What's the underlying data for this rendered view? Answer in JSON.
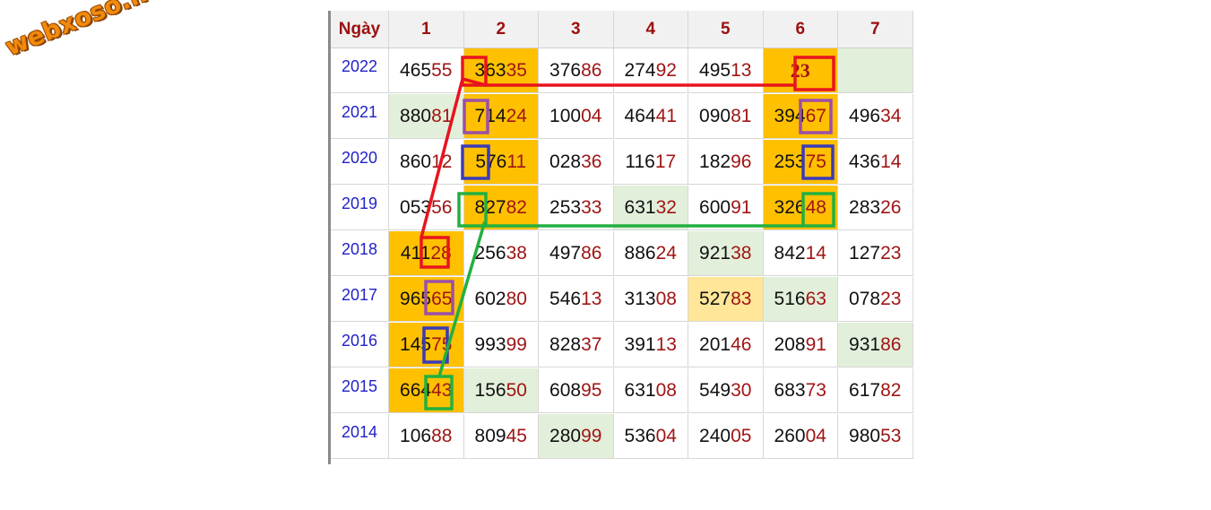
{
  "logo_text": "webxoso.net",
  "header": {
    "day_label": "Ngày",
    "months": [
      "1",
      "2",
      "3",
      "4",
      "5",
      "6",
      "7"
    ]
  },
  "rows": [
    {
      "year": "2022",
      "cells": [
        {
          "head": "465",
          "tail": "55",
          "bg": ""
        },
        {
          "head": "363",
          "tail": "35",
          "bg": "orange"
        },
        {
          "head": "376",
          "tail": "86",
          "bg": ""
        },
        {
          "head": "274",
          "tail": "92",
          "bg": ""
        },
        {
          "head": "495",
          "tail": "13",
          "bg": ""
        },
        {
          "head": "",
          "tail": "23",
          "bg": "orange",
          "special": true
        },
        {
          "head": "",
          "tail": "",
          "bg": "green"
        }
      ]
    },
    {
      "year": "2021",
      "cells": [
        {
          "head": "880",
          "tail": "81",
          "bg": "green"
        },
        {
          "head": "714",
          "tail": "24",
          "bg": "orange"
        },
        {
          "head": "100",
          "tail": "04",
          "bg": ""
        },
        {
          "head": "464",
          "tail": "41",
          "bg": ""
        },
        {
          "head": "090",
          "tail": "81",
          "bg": ""
        },
        {
          "head": "394",
          "tail": "67",
          "bg": "orange"
        },
        {
          "head": "496",
          "tail": "34",
          "bg": ""
        }
      ]
    },
    {
      "year": "2020",
      "cells": [
        {
          "head": "860",
          "tail": "12",
          "bg": ""
        },
        {
          "head": "576",
          "tail": "11",
          "bg": "orange"
        },
        {
          "head": "028",
          "tail": "36",
          "bg": ""
        },
        {
          "head": "116",
          "tail": "17",
          "bg": ""
        },
        {
          "head": "182",
          "tail": "96",
          "bg": ""
        },
        {
          "head": "253",
          "tail": "75",
          "bg": "orange"
        },
        {
          "head": "436",
          "tail": "14",
          "bg": ""
        }
      ]
    },
    {
      "year": "2019",
      "cells": [
        {
          "head": "053",
          "tail": "56",
          "bg": ""
        },
        {
          "head": "827",
          "tail": "82",
          "bg": "orange"
        },
        {
          "head": "253",
          "tail": "33",
          "bg": ""
        },
        {
          "head": "631",
          "tail": "32",
          "bg": "green"
        },
        {
          "head": "600",
          "tail": "91",
          "bg": ""
        },
        {
          "head": "326",
          "tail": "48",
          "bg": "orange"
        },
        {
          "head": "283",
          "tail": "26",
          "bg": ""
        }
      ]
    },
    {
      "year": "2018",
      "cells": [
        {
          "head": "411",
          "tail": "28",
          "bg": "orange"
        },
        {
          "head": "256",
          "tail": "38",
          "bg": ""
        },
        {
          "head": "497",
          "tail": "86",
          "bg": ""
        },
        {
          "head": "886",
          "tail": "24",
          "bg": ""
        },
        {
          "head": "921",
          "tail": "38",
          "bg": "green"
        },
        {
          "head": "842",
          "tail": "14",
          "bg": ""
        },
        {
          "head": "127",
          "tail": "23",
          "bg": ""
        }
      ]
    },
    {
      "year": "2017",
      "cells": [
        {
          "head": "965",
          "tail": "65",
          "bg": "orange"
        },
        {
          "head": "602",
          "tail": "80",
          "bg": ""
        },
        {
          "head": "546",
          "tail": "13",
          "bg": ""
        },
        {
          "head": "313",
          "tail": "08",
          "bg": ""
        },
        {
          "head": "527",
          "tail": "83",
          "bg": "yellow"
        },
        {
          "head": "516",
          "tail": "63",
          "bg": "green"
        },
        {
          "head": "078",
          "tail": "23",
          "bg": ""
        }
      ]
    },
    {
      "year": "2016",
      "cells": [
        {
          "head": "145",
          "tail": "75",
          "bg": "orange"
        },
        {
          "head": "993",
          "tail": "99",
          "bg": ""
        },
        {
          "head": "828",
          "tail": "37",
          "bg": ""
        },
        {
          "head": "391",
          "tail": "13",
          "bg": ""
        },
        {
          "head": "201",
          "tail": "46",
          "bg": ""
        },
        {
          "head": "208",
          "tail": "91",
          "bg": ""
        },
        {
          "head": "931",
          "tail": "86",
          "bg": "green"
        }
      ]
    },
    {
      "year": "2015",
      "cells": [
        {
          "head": "664",
          "tail": "43",
          "bg": "orange"
        },
        {
          "head": "156",
          "tail": "50",
          "bg": "green"
        },
        {
          "head": "608",
          "tail": "95",
          "bg": ""
        },
        {
          "head": "631",
          "tail": "08",
          "bg": ""
        },
        {
          "head": "549",
          "tail": "30",
          "bg": ""
        },
        {
          "head": "683",
          "tail": "73",
          "bg": ""
        },
        {
          "head": "617",
          "tail": "82",
          "bg": ""
        }
      ]
    },
    {
      "year": "2014",
      "cells": [
        {
          "head": "106",
          "tail": "88",
          "bg": ""
        },
        {
          "head": "809",
          "tail": "45",
          "bg": ""
        },
        {
          "head": "280",
          "tail": "99",
          "bg": "green"
        },
        {
          "head": "536",
          "tail": "04",
          "bg": ""
        },
        {
          "head": "240",
          "tail": "05",
          "bg": ""
        },
        {
          "head": "260",
          "tail": "04",
          "bg": ""
        },
        {
          "head": "980",
          "tail": "53",
          "bg": ""
        }
      ]
    }
  ],
  "annotation_colors": {
    "red": "#e8141e",
    "purple": "#9b4fa8",
    "blue": "#3b3bb8",
    "green": "#22b040"
  }
}
